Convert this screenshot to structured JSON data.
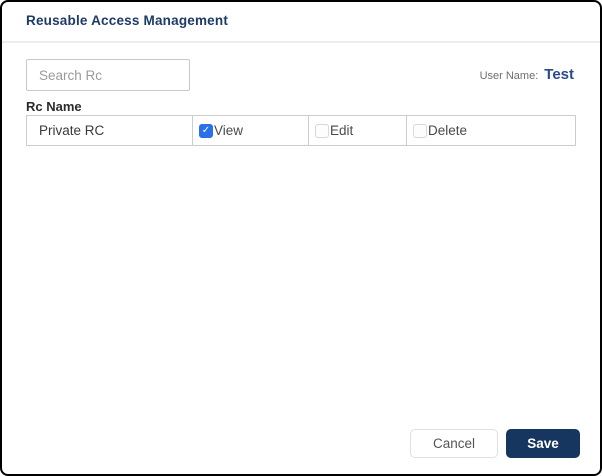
{
  "dialog": {
    "title": "Reusable Access Management"
  },
  "search": {
    "placeholder": "Search Rc"
  },
  "user": {
    "label": "User Name:",
    "value": "Test"
  },
  "table": {
    "header": "Rc Name",
    "rows": [
      {
        "name": "Private RC",
        "permissions": [
          {
            "label": "View",
            "checked": true
          },
          {
            "label": "Edit",
            "checked": false
          },
          {
            "label": "Delete",
            "checked": false
          }
        ]
      }
    ]
  },
  "footer": {
    "cancel_label": "Cancel",
    "save_label": "Save"
  },
  "colors": {
    "title_navy": "#1e3a66",
    "user_value_blue": "#2d4a8a",
    "checkbox_blue": "#2b6fea",
    "save_button_navy": "#17365f",
    "table_border": "#cccccc",
    "divider": "#ecebed",
    "outer_border": "#000000"
  }
}
